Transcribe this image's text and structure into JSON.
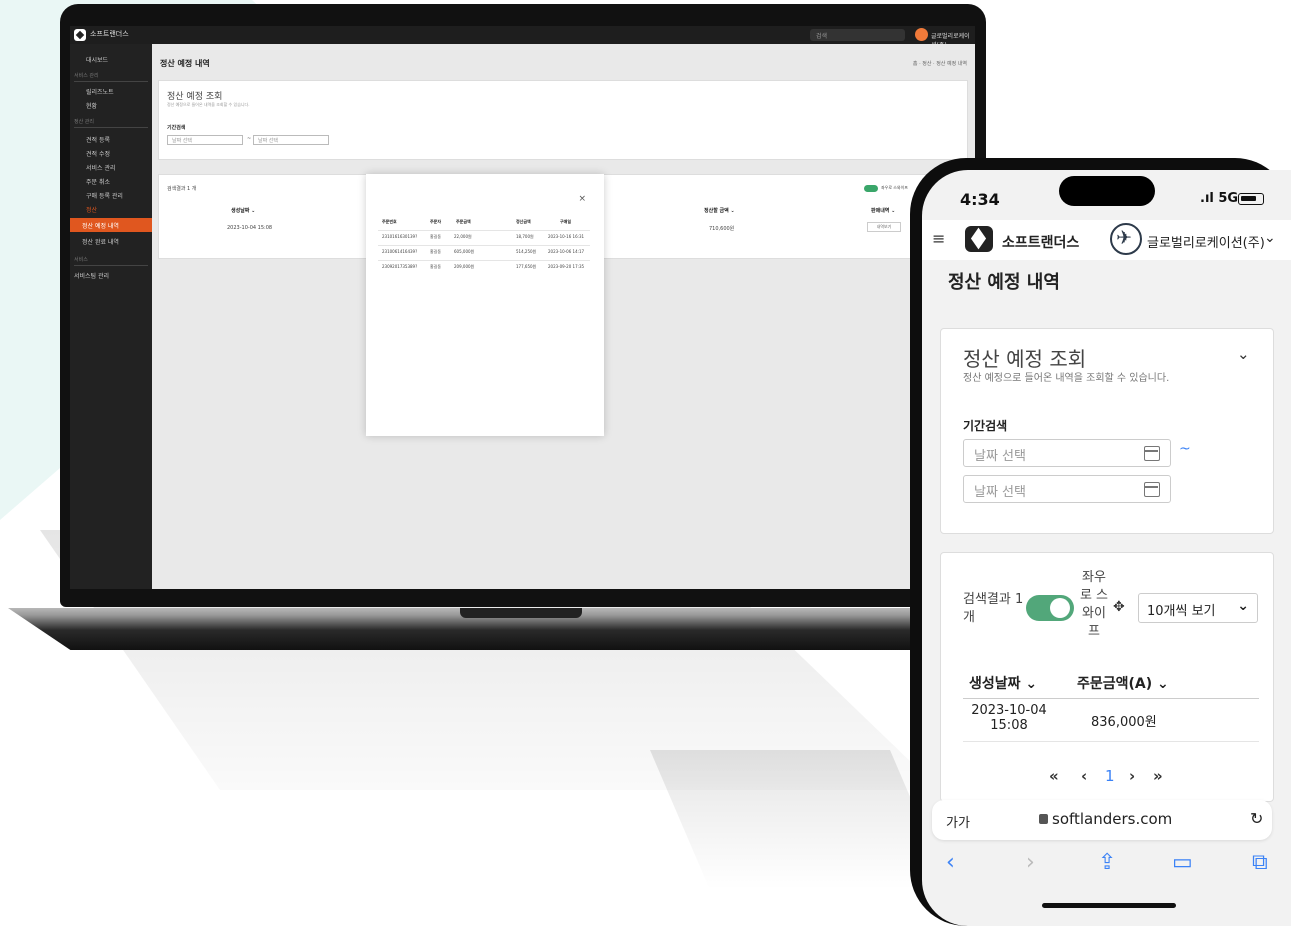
{
  "laptop": {
    "brand": "소프트랜더스",
    "search_placeholder": "검색",
    "user_org": "글로벌리로케이션(주)",
    "sidebar": {
      "dashboard": "대시보드",
      "sec1": "서비스 관리",
      "item_release": "릴리즈노트",
      "item_status": "현황",
      "sec2": "정산 관리",
      "item_buy_reg": "견적 등록",
      "item_buy_mod": "견적 수정",
      "item_service": "서비스 관리",
      "item_order": "주문 취소",
      "item_purchase": "구매 등록 관리",
      "item_settle": "정산",
      "item_settle_plan": "정산 예정 내역",
      "item_settle_done": "정산 완료 내역",
      "sec3": "서비스",
      "item_service_mgmt": "서비스팀 관리"
    },
    "page_title": "정산 예정 내역",
    "breadcrumb": "홈 · 정산 · 정산 예정 내역",
    "search_card": {
      "title": "정산 예정 조회",
      "subtitle": "정산 예정으로 들어온 내역을 조회할 수 있습니다.",
      "period_label": "기간검색",
      "date_placeholder": "날짜 선택",
      "tilde": "~"
    },
    "result_card": {
      "count": "검색결과 1 개",
      "toggle_label": "좌우로 스와이프",
      "col_date": "생성날짜 ⌄",
      "col_settle": "정산할 금액 ⌄",
      "col_detail": "판매내역 ⌄",
      "row_date": "2023-10-04 15:08",
      "row_settle": "710,600원",
      "detail_btn": "내역보기"
    },
    "modal": {
      "close": "×",
      "headers": [
        "주문번호",
        "주문자",
        "주문금액",
        "정산금액",
        "구매일"
      ],
      "rows": [
        [
          "2310161630139?",
          "홍길동",
          "22,000원",
          "18,700원",
          "2023-10-16 16:31"
        ],
        [
          "2310061416439?",
          "홍길동",
          "605,000원",
          "514,250원",
          "2023-10-06 14:17"
        ],
        [
          "2309201735389?",
          "홍길동",
          "209,000원",
          "177,650원",
          "2023-09-20 17:35"
        ]
      ]
    }
  },
  "phone": {
    "time": "4:34",
    "signal": "5G",
    "menu_icon": "≡",
    "brand": "소프트랜더스",
    "org": "글로벌리로케이션(주)",
    "page_title": "정산 예정 내역",
    "search_card": {
      "title": "정산 예정 조회",
      "subtitle": "정산 예정으로 들어온 내역을 조회할 수 있습니다.",
      "period_label": "기간검색",
      "date_placeholder": "날짜 선택",
      "tilde": "~"
    },
    "result_card": {
      "count": "검색결과 1 개",
      "toggle_label": "좌우로 스와이프",
      "page_size": "10개씩 보기",
      "col_date": "생성날짜 ⌄",
      "col_amount": "주문금액(A) ⌄",
      "row_date": "2023-10-04 15:08",
      "row_amount": "836,000원",
      "pager": {
        "first": "«",
        "prev": "‹",
        "current": "1",
        "next": "›",
        "last": "»"
      }
    },
    "browser": {
      "aa": "가가",
      "url": "softlanders.com"
    }
  }
}
